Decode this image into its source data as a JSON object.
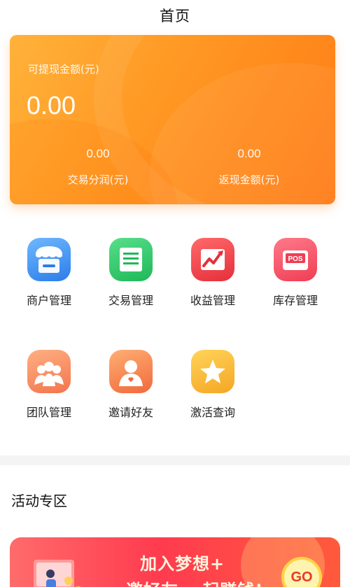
{
  "nav": {
    "title": "首页"
  },
  "balance": {
    "withdraw_label": "可提现金额(元)",
    "withdraw_value": "0.00",
    "stats": [
      {
        "value": "0.00",
        "label": "交易分润(元)"
      },
      {
        "value": "0.00",
        "label": "返现金额(元)"
      }
    ]
  },
  "menu": {
    "items": [
      {
        "label": "商户管理",
        "icon": "merchant-icon"
      },
      {
        "label": "交易管理",
        "icon": "transaction-icon"
      },
      {
        "label": "收益管理",
        "icon": "earnings-icon"
      },
      {
        "label": "库存管理",
        "icon": "inventory-icon"
      },
      {
        "label": "团队管理",
        "icon": "team-icon"
      },
      {
        "label": "邀请好友",
        "icon": "invite-friends-icon"
      },
      {
        "label": "激活查询",
        "icon": "activation-query-icon"
      }
    ]
  },
  "activity": {
    "section_title": "活动专区",
    "banner_line1": "加入梦想+",
    "banner_line2": "邀好友 一起赚钱!",
    "go_label": "GO"
  },
  "colors": {
    "card_orange": "#ff8a1c",
    "banner_red": "#ff3b4f"
  }
}
